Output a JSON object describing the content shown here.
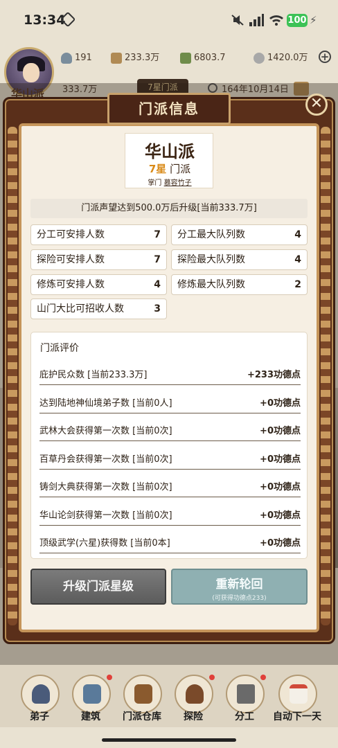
{
  "status_bar": {
    "time": "13:34",
    "battery": "100"
  },
  "hud": {
    "character_name": "华山派",
    "population": "191",
    "money": "233.3万",
    "food": "6803.7",
    "silver": "1420.0万",
    "reputation": "333.7万",
    "star_tab": "7星门派",
    "date": "164年10月14日"
  },
  "modal": {
    "title": "门派信息",
    "close_label": "✕",
    "sect": {
      "name": "华山派",
      "rank_number": "7星",
      "rank_suffix": "门派",
      "leader_prefix": "掌门",
      "leader_name": "慕容竹子"
    },
    "upgrade_note": "门派声望达到500.0万后升级[当前333.7万]",
    "stats": [
      {
        "label": "分工可安排人数",
        "value": "7"
      },
      {
        "label": "分工最大队列数",
        "value": "4"
      },
      {
        "label": "探险可安排人数",
        "value": "7"
      },
      {
        "label": "探险最大队列数",
        "value": "4"
      },
      {
        "label": "修炼可安排人数",
        "value": "4"
      },
      {
        "label": "修炼最大队列数",
        "value": "2"
      },
      {
        "label": "山门大比可招收人数",
        "value": "3"
      }
    ],
    "evaluation": {
      "title": "门派评价",
      "rows": [
        {
          "label": "庇护民众数 [当前233.3万]",
          "value": "+233功德点"
        },
        {
          "label": "达到陆地神仙境弟子数 [当前0人]",
          "value": "+0功德点"
        },
        {
          "label": "武林大会获得第一次数 [当前0次]",
          "value": "+0功德点"
        },
        {
          "label": "百草丹会获得第一次数 [当前0次]",
          "value": "+0功德点"
        },
        {
          "label": "铸剑大典获得第一次数 [当前0次]",
          "value": "+0功德点"
        },
        {
          "label": "华山论剑获得第一次数 [当前0次]",
          "value": "+0功德点"
        },
        {
          "label": "顶级武学(六星)获得数 [当前0本]",
          "value": "+0功德点"
        }
      ]
    },
    "buttons": {
      "upgrade": "升级门派星级",
      "rebirth": "重新轮回",
      "rebirth_sub": "(可获得功德点233)"
    }
  },
  "bottom_nav": [
    {
      "label": "弟子",
      "icon": "disciple-icon",
      "badge": false
    },
    {
      "label": "建筑",
      "icon": "building-icon",
      "badge": true
    },
    {
      "label": "门派仓库",
      "icon": "chest-icon",
      "badge": false
    },
    {
      "label": "探险",
      "icon": "explorer-icon",
      "badge": true
    },
    {
      "label": "分工",
      "icon": "hammer-icon",
      "badge": true
    },
    {
      "label": "自动下一天",
      "icon": "calendar-icon",
      "badge": false
    }
  ]
}
